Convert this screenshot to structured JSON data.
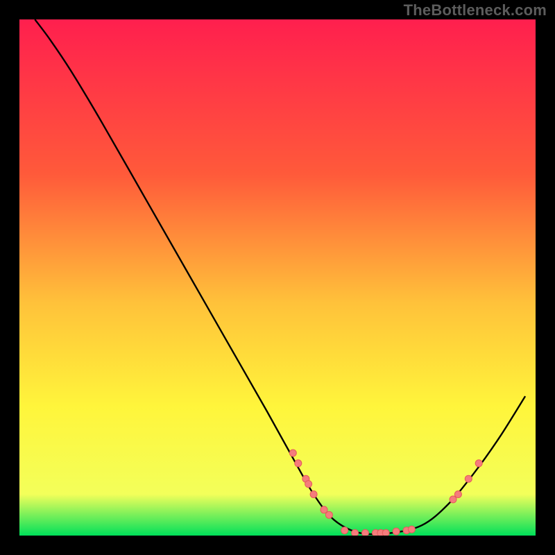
{
  "watermark": "TheBottleneck.com",
  "chart_data": {
    "type": "line",
    "title": "",
    "xlabel": "",
    "ylabel": "",
    "xlim": [
      0,
      100
    ],
    "ylim": [
      0,
      100
    ],
    "gradient_stops": [
      {
        "offset": 0,
        "color": "#ff1f4e"
      },
      {
        "offset": 30,
        "color": "#ff5a3a"
      },
      {
        "offset": 55,
        "color": "#ffc23a"
      },
      {
        "offset": 75,
        "color": "#fff53b"
      },
      {
        "offset": 92,
        "color": "#f3ff5a"
      },
      {
        "offset": 100,
        "color": "#00e05a"
      }
    ],
    "curve": [
      {
        "x": 3,
        "y": 100
      },
      {
        "x": 6,
        "y": 96
      },
      {
        "x": 10,
        "y": 90
      },
      {
        "x": 16,
        "y": 80
      },
      {
        "x": 24,
        "y": 66
      },
      {
        "x": 32,
        "y": 52
      },
      {
        "x": 40,
        "y": 38
      },
      {
        "x": 48,
        "y": 24
      },
      {
        "x": 53,
        "y": 15
      },
      {
        "x": 57,
        "y": 8
      },
      {
        "x": 61,
        "y": 3
      },
      {
        "x": 66,
        "y": 0.5
      },
      {
        "x": 72,
        "y": 0.5
      },
      {
        "x": 78,
        "y": 2
      },
      {
        "x": 83,
        "y": 6
      },
      {
        "x": 88,
        "y": 12
      },
      {
        "x": 93,
        "y": 19
      },
      {
        "x": 98,
        "y": 27
      }
    ],
    "markers": [
      {
        "x": 53,
        "y": 16,
        "r": 5
      },
      {
        "x": 54,
        "y": 14,
        "r": 5
      },
      {
        "x": 55.5,
        "y": 11,
        "r": 5
      },
      {
        "x": 56,
        "y": 10,
        "r": 5
      },
      {
        "x": 57,
        "y": 8,
        "r": 5
      },
      {
        "x": 59,
        "y": 5,
        "r": 5
      },
      {
        "x": 60,
        "y": 4,
        "r": 5
      },
      {
        "x": 63,
        "y": 1,
        "r": 5
      },
      {
        "x": 65,
        "y": 0.5,
        "r": 5
      },
      {
        "x": 67,
        "y": 0.5,
        "r": 5
      },
      {
        "x": 69,
        "y": 0.5,
        "r": 5
      },
      {
        "x": 70,
        "y": 0.5,
        "r": 5
      },
      {
        "x": 71,
        "y": 0.5,
        "r": 5
      },
      {
        "x": 73,
        "y": 0.8,
        "r": 5
      },
      {
        "x": 75,
        "y": 1,
        "r": 5
      },
      {
        "x": 76,
        "y": 1.2,
        "r": 5
      },
      {
        "x": 84,
        "y": 7,
        "r": 5
      },
      {
        "x": 85,
        "y": 8,
        "r": 5
      },
      {
        "x": 87,
        "y": 11,
        "r": 5
      },
      {
        "x": 89,
        "y": 14,
        "r": 5
      }
    ],
    "marker_fill": "#f57c7c",
    "marker_stroke": "#e55a5a",
    "curve_stroke": "#000000"
  }
}
